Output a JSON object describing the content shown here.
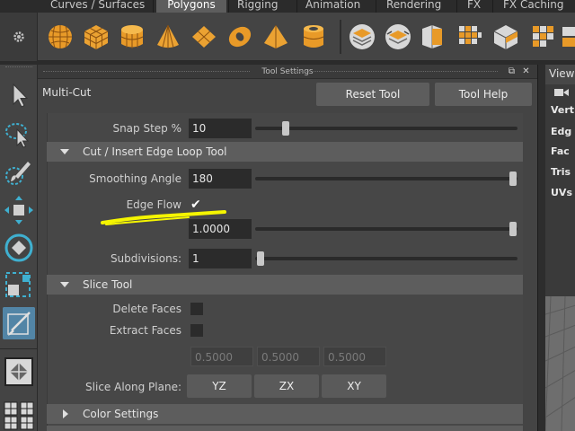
{
  "menu_tabs": [
    "Curves / Surfaces",
    "Polygons",
    "Rigging",
    "Animation",
    "Rendering",
    "FX",
    "FX Caching"
  ],
  "active_tab": "Polygons",
  "shelf": {
    "settings_icon": "gear-icon",
    "icons": [
      "sphere-icon",
      "cube-icon",
      "cylinder-icon",
      "cone-icon",
      "plane-icon",
      "torus-icon",
      "pyramid-icon",
      "pipe-icon",
      "combine-icon",
      "separate-icon",
      "extract-icon",
      "smooth-icon",
      "bevel-icon",
      "sculpt-icon",
      "mirror-icon"
    ]
  },
  "tools": [
    "select-arrow-icon",
    "lasso-icon",
    "paint-select-icon",
    "move-icon",
    "rotate-icon",
    "scale-icon",
    "multi-cut-icon",
    "layout-icon"
  ],
  "panel": {
    "title": "Tool Settings",
    "tool_name": "Multi-Cut",
    "reset_button": "Reset Tool",
    "help_button": "Tool Help"
  },
  "snap": {
    "label": "Snap Step %",
    "value": "10"
  },
  "cut_section": {
    "title": "Cut / Insert Edge Loop Tool",
    "smoothing_label": "Smoothing Angle",
    "smoothing_value": "180",
    "edge_flow_label": "Edge Flow",
    "edge_flow_value": "1.0000",
    "subdivisions_label": "Subdivisions:",
    "subdivisions_value": "1"
  },
  "slice_section": {
    "title": "Slice Tool",
    "delete_faces_label": "Delete Faces",
    "extract_faces_label": "Extract Faces",
    "fields": [
      "0.5000",
      "0.5000",
      "0.5000"
    ],
    "slice_plane_label": "Slice Along Plane:",
    "planes": [
      "YZ",
      "ZX",
      "XY"
    ]
  },
  "color_section": {
    "title": "Color Settings"
  },
  "right_panel": {
    "tab": "View",
    "items": [
      "Vert",
      "Edg",
      "Fac",
      "Tris",
      "UVs"
    ]
  },
  "colors": {
    "active_tool": "#5285a6",
    "annotation": "#f5f500",
    "accent_orange": "#f0a020"
  }
}
